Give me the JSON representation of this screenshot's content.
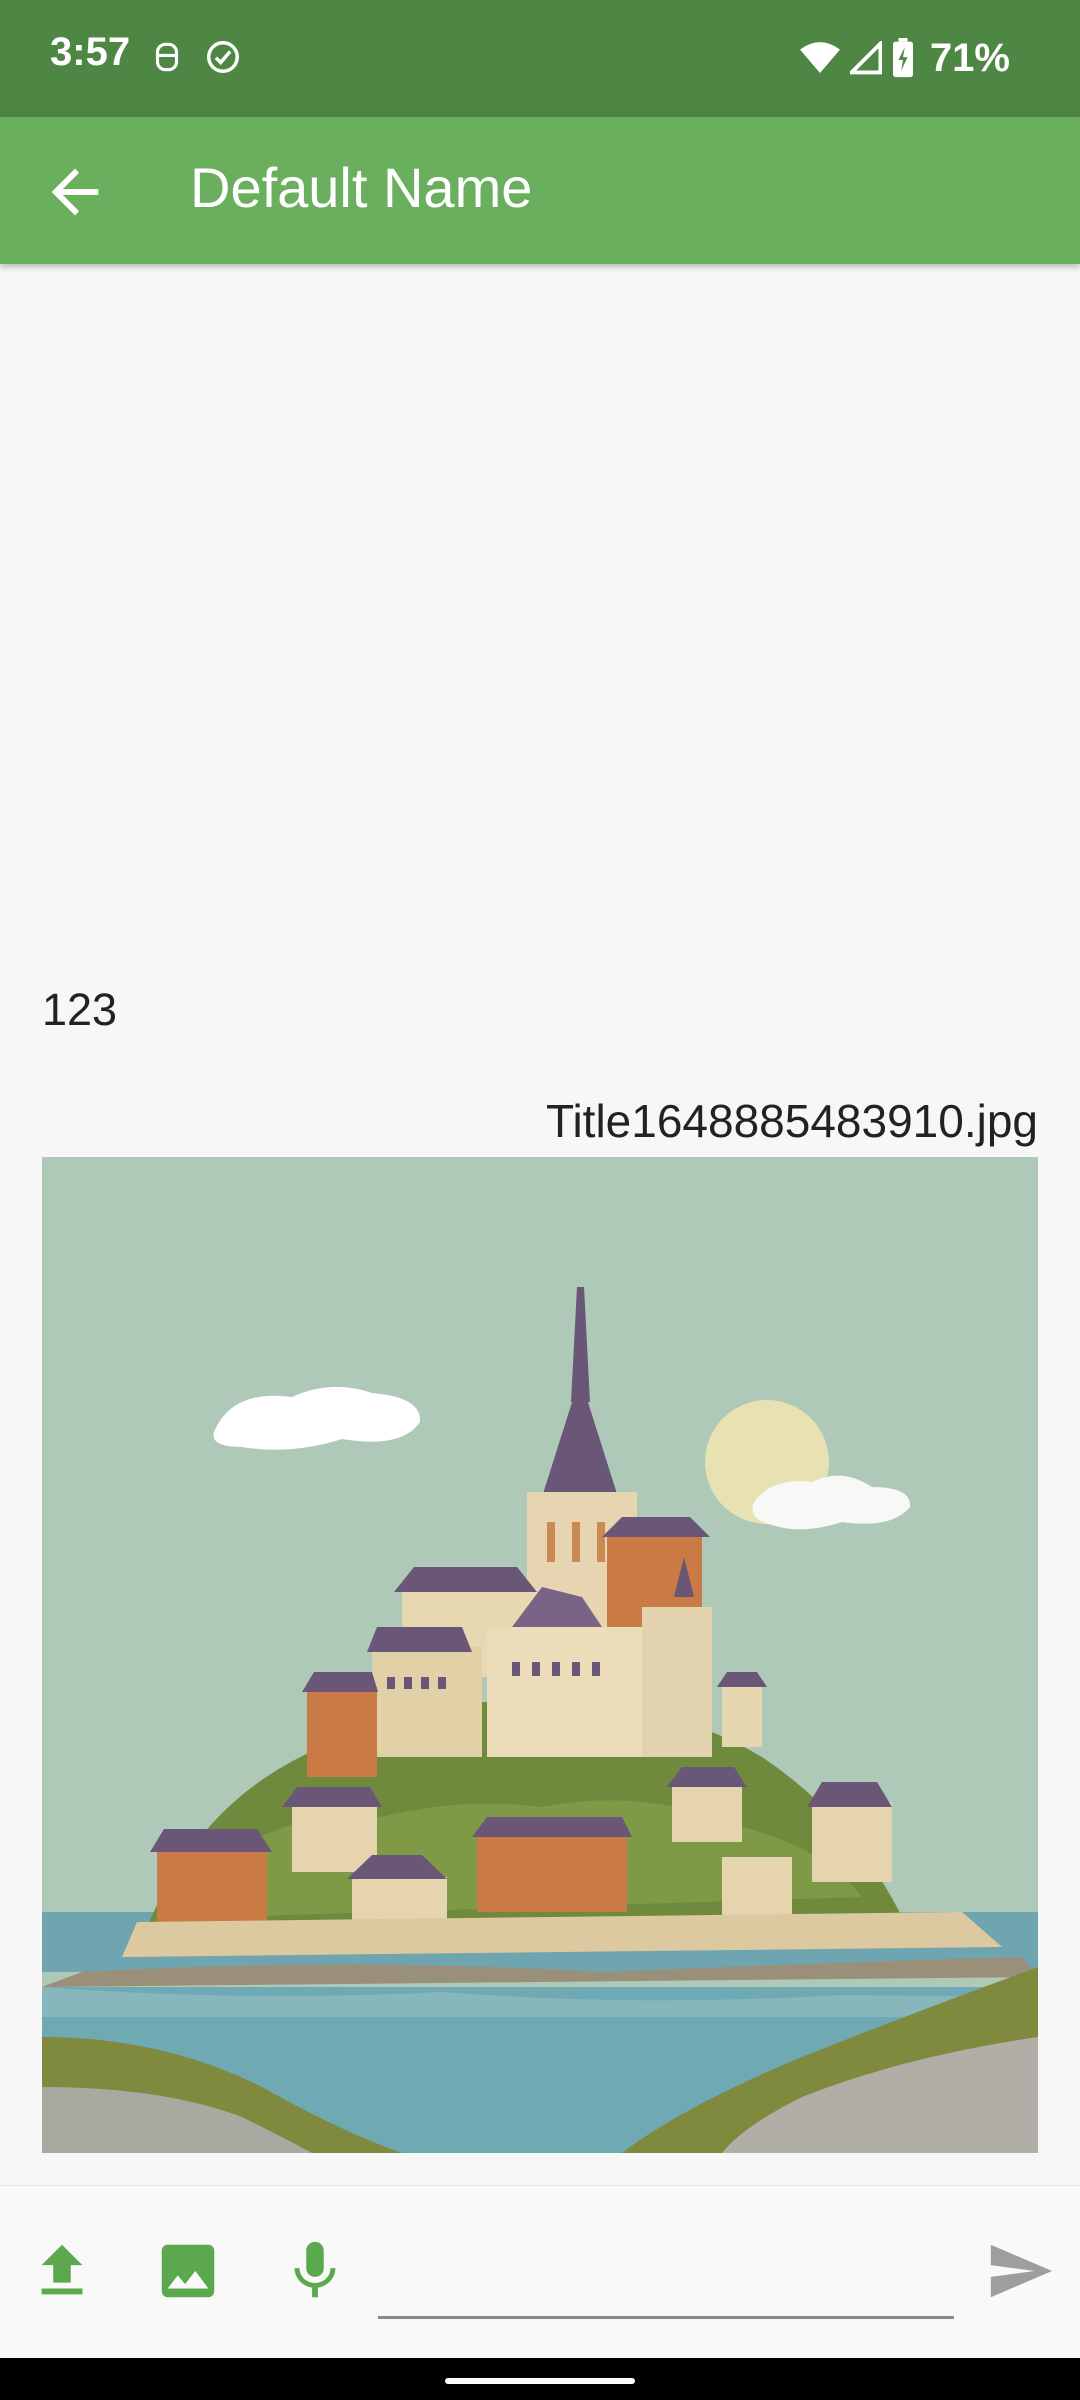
{
  "status_bar": {
    "time": "3:57",
    "battery": "71%",
    "icons": [
      "notification-icon",
      "check-circle-icon",
      "wifi-icon",
      "signal-icon",
      "battery-icon"
    ]
  },
  "app_bar": {
    "title": "Default Name",
    "back_icon": "arrow-back-icon"
  },
  "messages": {
    "text_message": "123",
    "image_message": {
      "file_name": "Title1648885483910.jpg",
      "image_subject": "mont-saint-michel-illustration"
    }
  },
  "composer": {
    "upload_icon": "upload-icon",
    "gallery_icon": "image-icon",
    "mic_icon": "microphone-icon",
    "input_value": "",
    "send_icon": "send-icon"
  },
  "colors": {
    "status_bar": "#4e8643",
    "app_bar": "#6aaf5e",
    "accent": "#5ba84e",
    "background": "#f7f7f7"
  }
}
